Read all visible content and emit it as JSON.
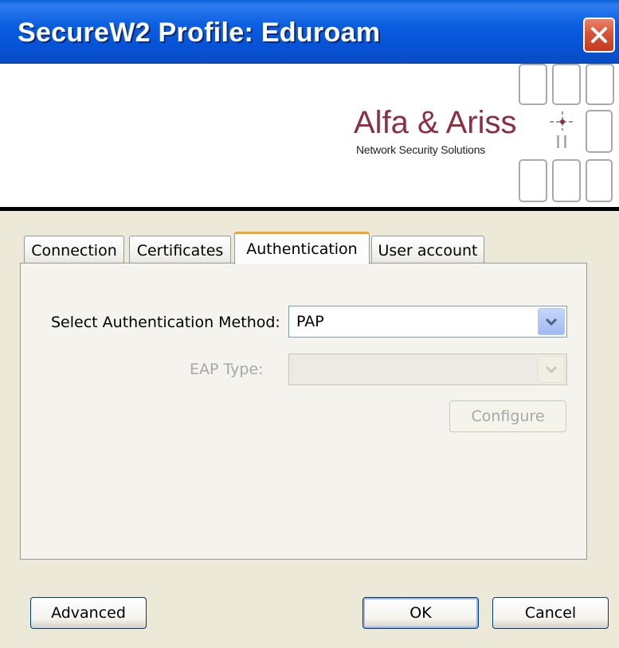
{
  "window": {
    "title": "SecureW2 Profile: Eduroam",
    "close_icon": "close-icon"
  },
  "banner": {
    "brand_name": "Alfa & Ariss",
    "tagline": "Network Security Solutions",
    "brand_color": "#8b2f45"
  },
  "tabs": [
    {
      "label": "Connection",
      "active": false
    },
    {
      "label": "Certificates",
      "active": false
    },
    {
      "label": "Authentication",
      "active": true
    },
    {
      "label": "User account",
      "active": false
    }
  ],
  "form": {
    "auth_method_label": "Select Authentication Method:",
    "auth_method_value": "PAP",
    "eap_type_label": "EAP Type:",
    "eap_type_value": "",
    "configure_label": "Configure"
  },
  "footer": {
    "advanced_label": "Advanced",
    "ok_label": "OK",
    "cancel_label": "Cancel"
  },
  "colors": {
    "titlebar": "#0b5ee0",
    "dialog_bg": "#ece9d8",
    "active_tab_accent": "#f3a52b",
    "close_button": "#d9533a"
  }
}
